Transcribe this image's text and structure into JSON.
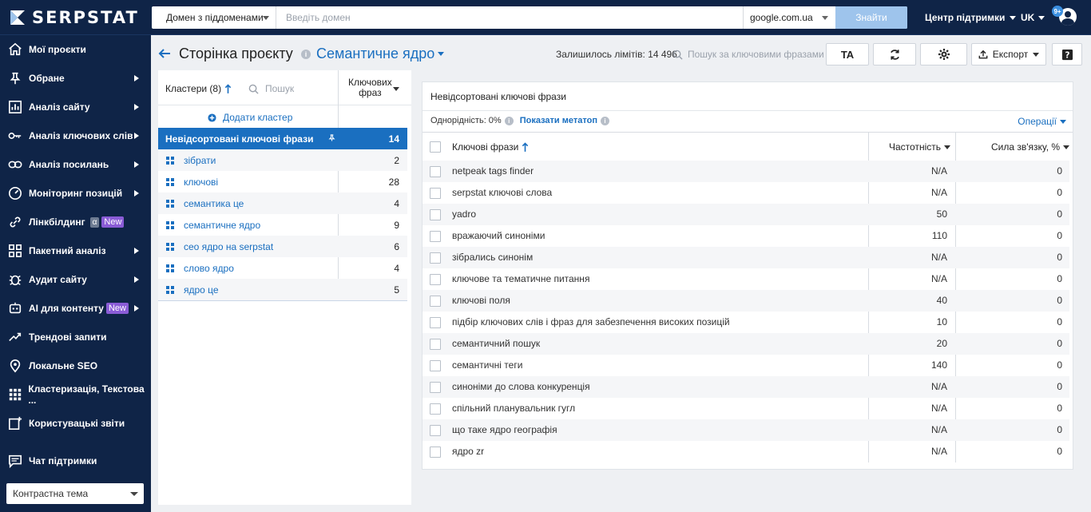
{
  "topbar": {
    "logo_text": "SERPSTAT",
    "domain_mode": "Домен з піддоменами",
    "domain_placeholder": "Введіть домен",
    "engine": "google.com.ua",
    "find_label": "Знайти",
    "support_label": "Центр підтримки",
    "lang_label": "UK",
    "notif_count": "9+"
  },
  "sidebar": {
    "items": [
      {
        "label": "Мої проєкти",
        "icon": "home-icon",
        "arrow": false
      },
      {
        "label": "Обране",
        "icon": "pin-icon",
        "arrow": true
      },
      {
        "label": "Аналіз сайту",
        "icon": "chart-icon",
        "arrow": true
      },
      {
        "label": "Аналіз ключових слів",
        "icon": "key-icon",
        "arrow": true
      },
      {
        "label": "Аналіз посилань",
        "icon": "link-icon",
        "arrow": true
      },
      {
        "label": "Моніторинг позицій",
        "icon": "gauge-icon",
        "arrow": true
      },
      {
        "label": "Лінкбілдинг",
        "icon": "chain-icon",
        "arrow": false,
        "badge_q": "α",
        "badge": "New"
      },
      {
        "label": "Пакетний аналіз",
        "icon": "blocks-icon",
        "arrow": true
      },
      {
        "label": "Аудит сайту",
        "icon": "bug-icon",
        "arrow": true
      },
      {
        "label": "AI для контенту",
        "icon": "ai-icon",
        "arrow": true,
        "badge": "New"
      },
      {
        "label": "Трендові запити",
        "icon": "trend-icon",
        "arrow": false
      },
      {
        "label": "Локальне SEO",
        "icon": "location-icon",
        "arrow": false
      },
      {
        "label": "Кластеризація, Текстова ...",
        "icon": "dots-grid-icon",
        "arrow": false
      },
      {
        "label": "Користувацькі звіти",
        "icon": "report-add-icon",
        "arrow": false
      }
    ],
    "chat_label": "Чат підтримки",
    "theme_label": "Контрастна тема"
  },
  "header": {
    "page_title": "Сторінка проєкту",
    "section": "Семантичне ядро",
    "limits": "Залишилось лімітів: 14 496",
    "kw_search_placeholder": "Пошук за ключовими фразами",
    "ta_label": "TA",
    "export_label": "Експорт"
  },
  "clusters": {
    "title": "Кластери (8)",
    "search_placeholder": "Пошук",
    "kw_col_line1": "Ключових",
    "kw_col_line2": "фраз",
    "add_label": "Додати кластер",
    "rows": [
      {
        "name": "Невідсортовані ключові фрази",
        "count": "14"
      },
      {
        "name": "зібрати",
        "count": "2"
      },
      {
        "name": "ключові",
        "count": "28"
      },
      {
        "name": "семантика це",
        "count": "4"
      },
      {
        "name": "семантичне ядро",
        "count": "9"
      },
      {
        "name": "сео ядро на serpstat",
        "count": "6"
      },
      {
        "name": "слово ядро",
        "count": "4"
      },
      {
        "name": "ядро це",
        "count": "5"
      }
    ]
  },
  "keywords": {
    "title": "Невідсортовані ключові фрази",
    "uniformity": "Однорідність: 0%",
    "show_meta": "Показати метатоп",
    "operations": "Операції",
    "col_phrase": "Ключові фрази",
    "col_freq": "Частотність",
    "col_rel": "Сила зв'язку, %",
    "rows": [
      {
        "phrase": "netpeak tags finder",
        "freq": "N/A",
        "rel": "0"
      },
      {
        "phrase": "serpstat ключові слова",
        "freq": "N/A",
        "rel": "0"
      },
      {
        "phrase": "yadro",
        "freq": "50",
        "rel": "0"
      },
      {
        "phrase": "вражаючий синоніми",
        "freq": "110",
        "rel": "0"
      },
      {
        "phrase": "зібрались синонім",
        "freq": "N/A",
        "rel": "0"
      },
      {
        "phrase": "ключове та тематичне питання",
        "freq": "N/A",
        "rel": "0"
      },
      {
        "phrase": "ключові поля",
        "freq": "40",
        "rel": "0"
      },
      {
        "phrase": "підбір ключових слів і фраз для забезпечення високих позицій",
        "freq": "10",
        "rel": "0"
      },
      {
        "phrase": "семантичний пошук",
        "freq": "20",
        "rel": "0"
      },
      {
        "phrase": "семантичні теги",
        "freq": "140",
        "rel": "0"
      },
      {
        "phrase": "синоніми до слова конкуренція",
        "freq": "N/A",
        "rel": "0"
      },
      {
        "phrase": "спільний планувальник гугл",
        "freq": "N/A",
        "rel": "0"
      },
      {
        "phrase": "що таке ядро географія",
        "freq": "N/A",
        "rel": "0"
      },
      {
        "phrase": "ядро zr",
        "freq": "N/A",
        "rel": "0"
      }
    ]
  },
  "colors": {
    "sidebar_bg": "#0f2447",
    "accent": "#1a6fc0",
    "badge_new": "#8a5cd6"
  }
}
